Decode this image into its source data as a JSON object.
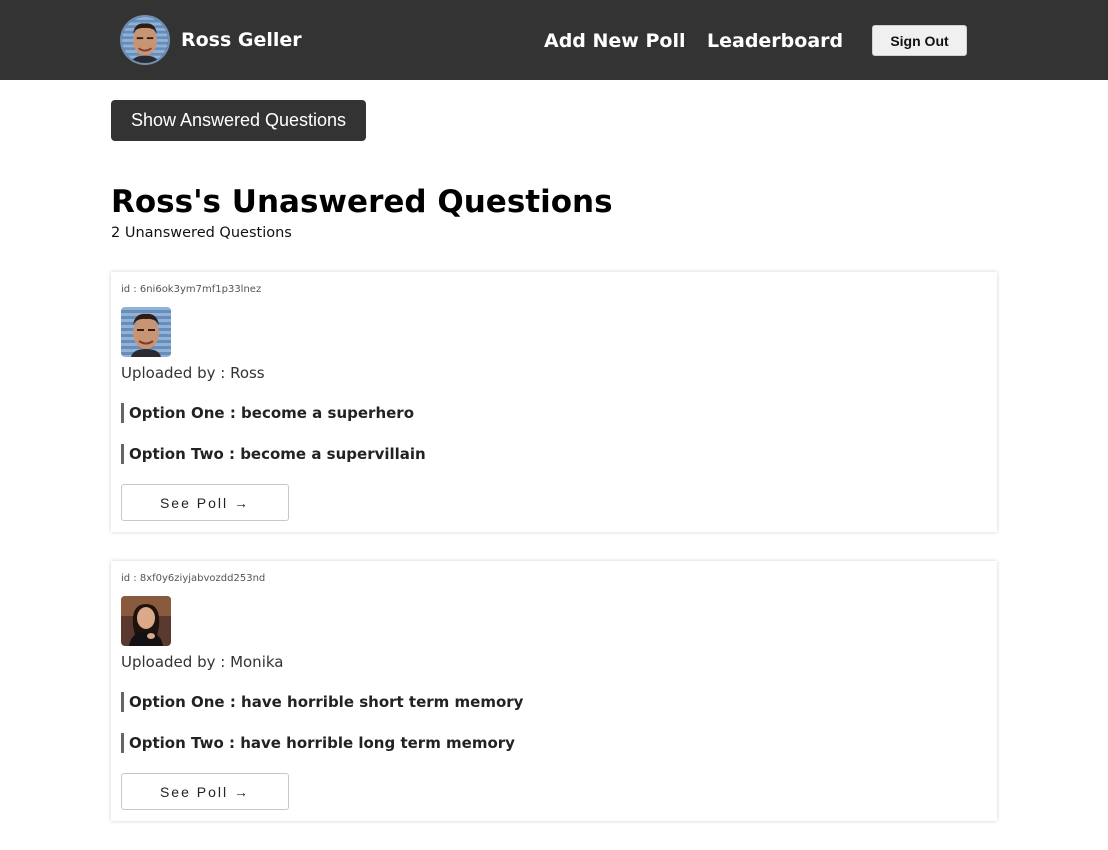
{
  "header": {
    "user_name": "Ross Geller",
    "nav": {
      "add_poll": "Add New Poll",
      "leaderboard": "Leaderboard"
    },
    "sign_out": "Sign Out"
  },
  "toggle_button": "Show Answered Questions",
  "page": {
    "title": "Ross's Unaswered Questions",
    "subtitle": "2 Unanswered Questions"
  },
  "questions": [
    {
      "id_text": "id : 6ni6ok3ym7mf1p33lnez",
      "uploader": "Uploaded by : Ross",
      "option_one": "Option One : become a superhero",
      "option_two": "Option Two : become a supervillain",
      "button": "See Poll →"
    },
    {
      "id_text": "id : 8xf0y6ziyjabvozdd253nd",
      "uploader": "Uploaded by : Monika",
      "option_one": "Option One : have horrible short term memory",
      "option_two": "Option Two : have horrible long term memory",
      "button": "See Poll →"
    }
  ],
  "colors": {
    "header_bg": "#333333",
    "button_dark": "#333333",
    "option_bar": "#666666"
  }
}
